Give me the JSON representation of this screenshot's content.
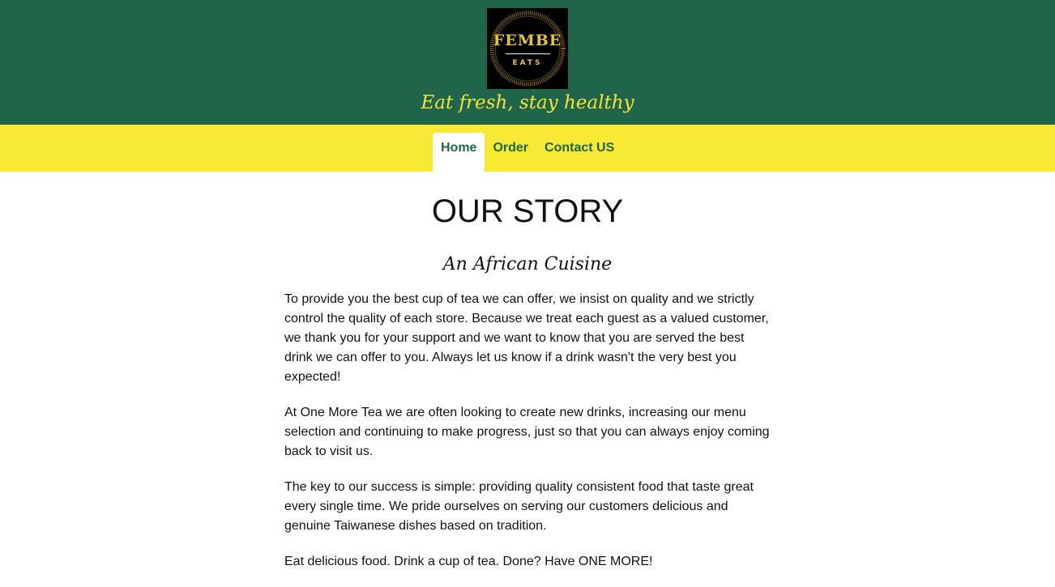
{
  "header": {
    "logo": {
      "name": "FEMBE",
      "sub": "EATS"
    },
    "tagline": "Eat fresh, stay healthy"
  },
  "nav": {
    "items": [
      {
        "label": "Home",
        "active": true
      },
      {
        "label": "Order",
        "active": false
      },
      {
        "label": "Contact US",
        "active": false
      }
    ]
  },
  "main": {
    "title": "OUR STORY",
    "subtitle": "An African Cuisine",
    "paragraphs": [
      "To provide you the best cup of tea we can offer, we insist on quality and we strictly control the quality of each store. Because we treat each guest as a valued customer, we thank you for your support and we want to know that you are served the best drink we can offer to you. Always let us know if a drink wasn't the very best you expected!",
      "At One More Tea we are often looking to create new drinks, increasing our menu selection and continuing to make progress, just so that you can always enjoy coming back to visit us.",
      "The key to our success is simple: providing quality consistent food that taste great every single time. We pride ourselves on serving our customers delicious and genuine Taiwanese dishes based on tradition.",
      "Eat delicious food. Drink a cup of tea. Done? Have ONE MORE!"
    ]
  },
  "colors": {
    "header_bg": "#20654a",
    "nav_bg": "#f9e937",
    "accent_text": "#f5e43c"
  }
}
